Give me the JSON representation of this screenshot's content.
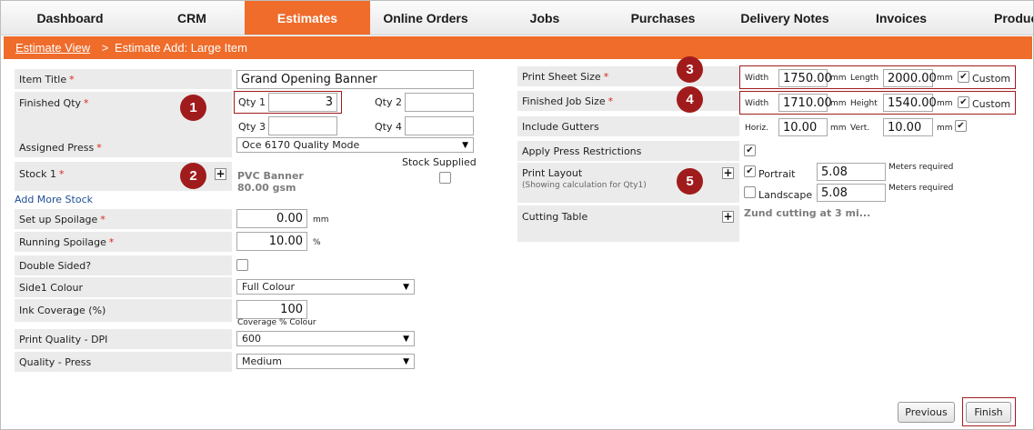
{
  "nav": {
    "tabs": [
      "Dashboard",
      "CRM",
      "Estimates",
      "Online Orders",
      "Jobs",
      "Purchases",
      "Delivery Notes",
      "Invoices",
      "Products"
    ]
  },
  "breadcrumb": {
    "link": "Estimate View",
    "separator": ">",
    "current": "Estimate Add: Large Item"
  },
  "colors": {
    "accent": "#ef6c2b",
    "badge": "#a01c1c"
  },
  "left": {
    "item_title": {
      "label": "Item Title",
      "value": "Grand Opening Banner"
    },
    "finished_qty": {
      "label": "Finished Qty",
      "qty1_label": "Qty 1",
      "qty1": "3",
      "qty2_label": "Qty 2",
      "qty2": "",
      "qty3_label": "Qty 3",
      "qty3": "",
      "qty4_label": "Qty 4",
      "qty4": ""
    },
    "assigned_press": {
      "label": "Assigned Press",
      "value": "Oce 6170 Quality Mode"
    },
    "stock": {
      "label": "Stock 1",
      "stock_supplied": "Stock Supplied",
      "name": "PVC Banner",
      "weight": "80.00 gsm",
      "add_more": "Add More Stock"
    },
    "setup_spoilage": {
      "label": "Set up Spoilage",
      "value": "0.00",
      "unit": "mm"
    },
    "running_spoilage": {
      "label": "Running Spoilage",
      "value": "10.00",
      "unit": "%"
    },
    "double_sided": {
      "label": "Double Sided?"
    },
    "side1_colour": {
      "label": "Side1 Colour",
      "value": "Full Colour"
    },
    "ink_coverage": {
      "label": "Ink Coverage (%)",
      "value": "100",
      "note": "Coverage % Colour"
    },
    "print_quality": {
      "label": "Print Quality - DPI",
      "value": "600"
    },
    "quality_press": {
      "label": "Quality - Press",
      "value": "Medium"
    }
  },
  "right": {
    "print_sheet": {
      "label": "Print Sheet Size",
      "width_label": "Width",
      "width": "1750.00",
      "unit1": "mm",
      "length_label": "Length",
      "length": "2000.00",
      "unit2": "mm",
      "custom": "Custom"
    },
    "finished_job": {
      "label": "Finished Job Size",
      "width_label": "Width",
      "width": "1710.00",
      "unit1": "mm",
      "height_label": "Height",
      "height": "1540.00",
      "unit2": "mm",
      "custom": "Custom"
    },
    "gutters": {
      "label": "Include Gutters",
      "horiz_label": "Horiz.",
      "horiz": "10.00",
      "unit1": "mm",
      "vert_label": "Vert.",
      "vert": "10.00",
      "unit2": "mm"
    },
    "press_restrictions": {
      "label": "Apply Press Restrictions"
    },
    "print_layout": {
      "label": "Print Layout",
      "note": "(Showing calculation for Qty1)",
      "portrait_label": "Portrait",
      "portrait": "5.08",
      "landscape_label": "Landscape",
      "landscape": "5.08",
      "meters": "Meters required"
    },
    "cutting_table": {
      "label": "Cutting Table",
      "value": "Zund cutting at 3 mi..."
    }
  },
  "badges": [
    "1",
    "2",
    "3",
    "4",
    "5"
  ],
  "buttons": {
    "previous": "Previous",
    "finish": "Finish"
  }
}
